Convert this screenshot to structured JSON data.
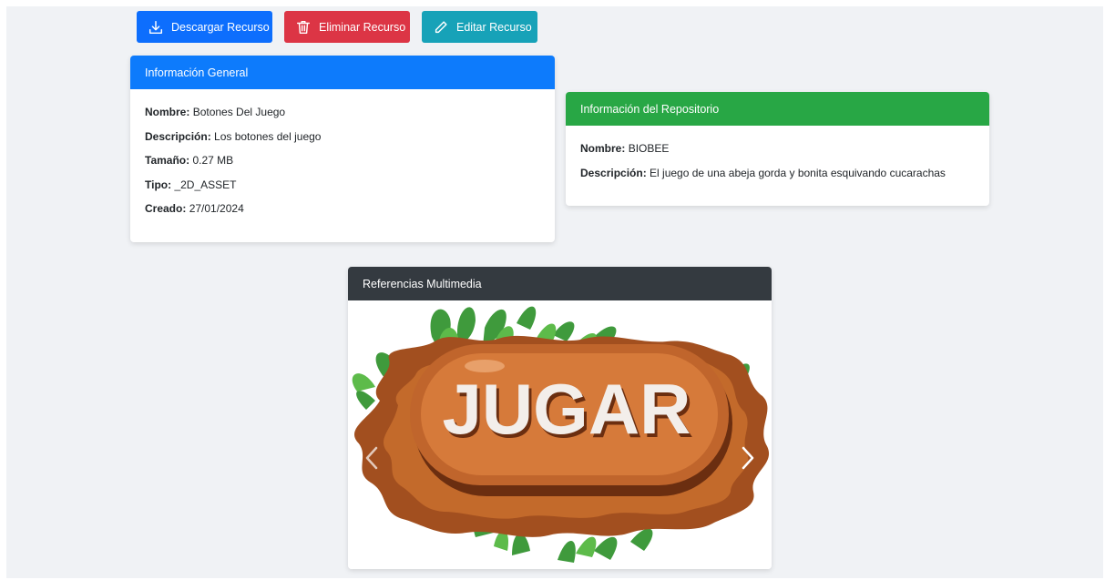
{
  "toolbar": {
    "download_label": "Descargar Recurso",
    "delete_label": "Eliminar Recurso",
    "edit_label": "Editar Recurso",
    "download_icon": "download-icon",
    "delete_icon": "trash-icon",
    "edit_icon": "pencil-icon",
    "colors": {
      "download": "#0d6efd",
      "delete": "#dc3545",
      "edit": "#17a2b8"
    }
  },
  "general_info": {
    "header": "Información General",
    "header_color": "#0d7bfc",
    "fields": [
      {
        "label": "Nombre:",
        "value": "Botones Del Juego"
      },
      {
        "label": "Descripción:",
        "value": "Los botones del juego"
      },
      {
        "label": "Tamaño:",
        "value": "0.27 MB"
      },
      {
        "label": "Tipo:",
        "value": "_2D_ASSET"
      },
      {
        "label": "Creado:",
        "value": "27/01/2024"
      }
    ]
  },
  "repo_info": {
    "header": "Información del Repositorio",
    "header_color": "#28a745",
    "fields": [
      {
        "label": "Nombre:",
        "value": "BIOBEE"
      },
      {
        "label": "Descripción:",
        "value": "El juego de una abeja gorda y bonita esquivando cucarachas"
      }
    ]
  },
  "media": {
    "header": "Referencias Multimedia",
    "header_color": "#343a40",
    "image_text": "JUGAR",
    "prev_icon": "chevron-left-icon",
    "next_icon": "chevron-right-icon"
  }
}
